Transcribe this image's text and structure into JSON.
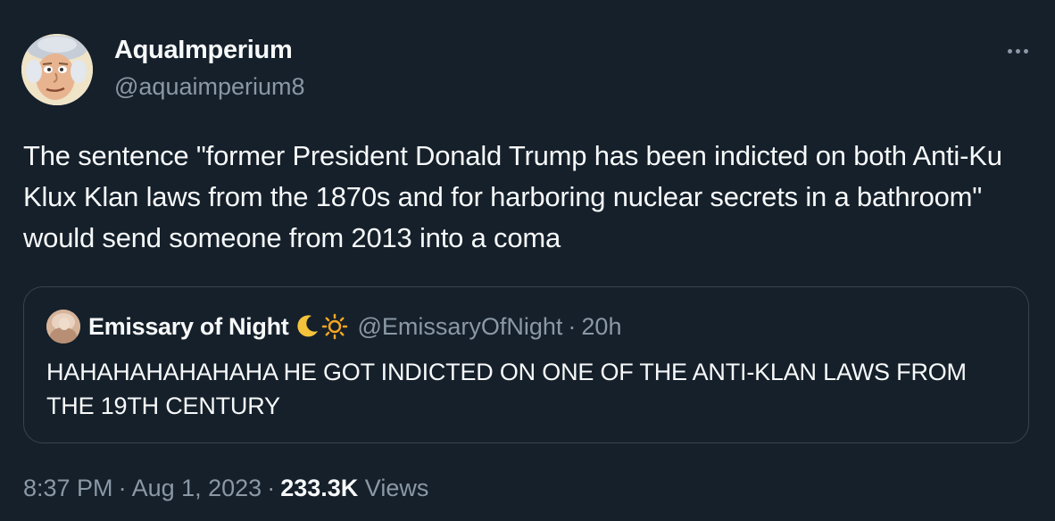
{
  "author": {
    "display_name": "AquaImperium",
    "handle": "@aquaimperium8"
  },
  "tweet": {
    "text": "The sentence \"former President Donald Trump has been indicted on both Anti-Ku Klux Klan laws from the 1870s and for harboring nuclear secrets in a bathroom\" would send someone from 2013 into a coma"
  },
  "quoted_tweet": {
    "display_name": "Emissary of Night",
    "emoji": [
      "crescent-moon",
      "sun"
    ],
    "handle": "@EmissaryOfNight",
    "separator": "·",
    "time_ago": "20h",
    "text": "HAHAHAHAHAHAHA HE GOT INDICTED ON ONE OF THE ANTI-KLAN LAWS FROM THE 19TH CENTURY"
  },
  "meta": {
    "time": "8:37 PM",
    "date": "Aug 1, 2023",
    "separator": "·",
    "views_count": "233.3K",
    "views_label": "Views"
  },
  "colors": {
    "background": "#15202b",
    "text_primary": "#f7f9f9",
    "text_secondary": "#8b98a5",
    "border": "#38444d"
  }
}
